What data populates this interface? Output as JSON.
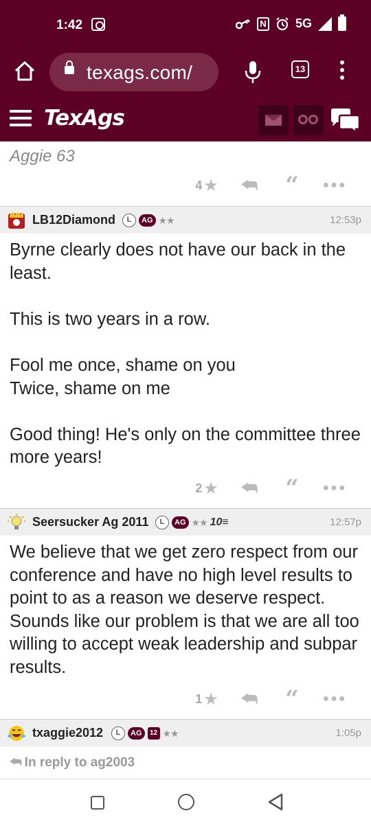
{
  "status_bar": {
    "time": "1:42",
    "network": "5G",
    "nfc_label": "N",
    "icons": [
      "screen-record-icon",
      "key-icon",
      "nfc-icon",
      "alarm-icon",
      "signal-icon",
      "battery-icon"
    ]
  },
  "browser": {
    "url": "texags.com/",
    "tab_count": "13",
    "icons": [
      "home-icon",
      "lock-icon",
      "mic-icon",
      "tabs-icon",
      "menu-icon"
    ]
  },
  "site_header": {
    "logo": "TexAgs",
    "icons": [
      "hamburger-menu-icon",
      "mail-icon",
      "binoculars-icon",
      "chat-icon"
    ]
  },
  "previous_post": {
    "signature": "Aggie 63",
    "likes": "4"
  },
  "posts": [
    {
      "username": "LB12Diamond",
      "badge_l": "L",
      "badge_ag": "AG",
      "stars": "★★",
      "time": "12:53p",
      "paragraphs": [
        "Byrne clearly does not have our back in the least.",
        "",
        "This is two years in a row.",
        "",
        "Fool me once, shame on you",
        "Twice, shame on me",
        "",
        "Good thing! He's only on the committee three more years!"
      ],
      "likes": "2"
    },
    {
      "username": "Seersucker Ag 2011",
      "badge_l": "L",
      "badge_ag": "AG",
      "stars": "★★",
      "badge_10": "10≡",
      "time": "12:57p",
      "paragraphs": [
        "We believe that we get zero respect from our conference and have no high level results to point to as a reason we deserve respect. Sounds like our problem is that we are all too willing to accept weak leadership and subpar results."
      ],
      "likes": "1"
    },
    {
      "username": "txaggie2012",
      "badge_l": "L",
      "badge_ag": "AG",
      "badge_12": "12",
      "stars": "★★",
      "time": "1:05p",
      "reply_to": "In reply to ag2003"
    }
  ],
  "action_icons": [
    "star-icon",
    "reply-icon",
    "quote-icon",
    "more-icon"
  ],
  "colors": {
    "maroon": "#5c0025",
    "header_bg": "#efefef"
  }
}
